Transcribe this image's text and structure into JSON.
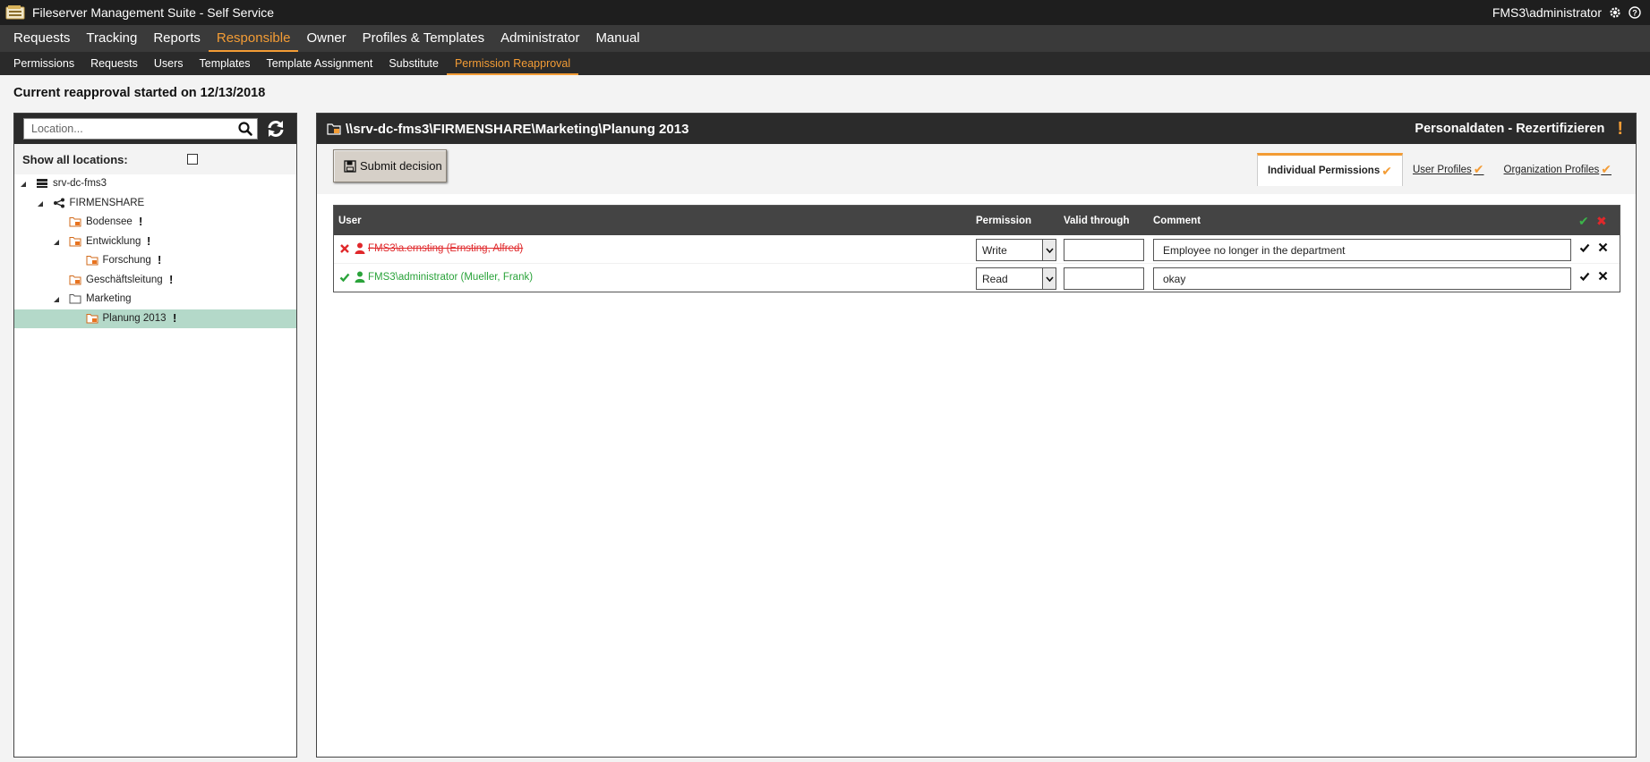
{
  "app": {
    "title": "Fileserver Management Suite - Self Service",
    "user": "FMS3\\administrator"
  },
  "main_nav": [
    {
      "label": "Requests",
      "active": false
    },
    {
      "label": "Tracking",
      "active": false
    },
    {
      "label": "Reports",
      "active": false
    },
    {
      "label": "Responsible",
      "active": true
    },
    {
      "label": "Owner",
      "active": false
    },
    {
      "label": "Profiles & Templates",
      "active": false
    },
    {
      "label": "Administrator",
      "active": false
    },
    {
      "label": "Manual",
      "active": false
    }
  ],
  "sub_nav": [
    {
      "label": "Permissions",
      "active": false
    },
    {
      "label": "Requests",
      "active": false
    },
    {
      "label": "Users",
      "active": false
    },
    {
      "label": "Templates",
      "active": false
    },
    {
      "label": "Template Assignment",
      "active": false
    },
    {
      "label": "Substitute",
      "active": false
    },
    {
      "label": "Permission Reapproval",
      "active": true
    }
  ],
  "heading": "Current reapproval started on 12/13/2018",
  "left": {
    "search_placeholder": "Location...",
    "show_all_label": "Show all locations:",
    "show_all_checked": false,
    "tree": [
      {
        "label": "srv-dc-fms3",
        "icon": "server-icon",
        "level": 0,
        "toggle": "expanded",
        "flag": false,
        "selected": false
      },
      {
        "label": "FIRMENSHARE",
        "icon": "share-icon",
        "level": 1,
        "toggle": "expanded",
        "flag": false,
        "selected": false
      },
      {
        "label": "Bodensee",
        "icon": "flagged-folder-icon",
        "level": 2,
        "toggle": "none",
        "flag": true,
        "selected": false
      },
      {
        "label": "Entwicklung",
        "icon": "flagged-folder-icon",
        "level": 2,
        "toggle": "expanded",
        "flag": true,
        "selected": false
      },
      {
        "label": "Forschung",
        "icon": "flagged-folder-icon",
        "level": 3,
        "toggle": "none",
        "flag": true,
        "selected": false
      },
      {
        "label": "Geschäftsleitung",
        "icon": "flagged-folder-icon",
        "level": 2,
        "toggle": "none",
        "flag": true,
        "selected": false
      },
      {
        "label": "Marketing",
        "icon": "folder-icon",
        "level": 2,
        "toggle": "expanded",
        "flag": false,
        "selected": false
      },
      {
        "label": "Planung 2013",
        "icon": "flagged-folder-icon",
        "level": 3,
        "toggle": "none",
        "flag": true,
        "selected": true
      }
    ]
  },
  "right": {
    "path": "\\\\srv-dc-fms3\\FIRMENSHARE\\Marketing\\Planung 2013",
    "category": "Personaldaten - Rezertifizieren",
    "submit_label": "Submit decision",
    "tabs": [
      {
        "label": "Individual Permissions",
        "active": true
      },
      {
        "label": "User Profiles",
        "active": false
      },
      {
        "label": "Organization Profiles",
        "active": false
      }
    ],
    "columns": {
      "user": "User",
      "permission": "Permission",
      "valid_through": "Valid through",
      "comment": "Comment"
    },
    "rows": [
      {
        "status": "rejected",
        "user": "FMS3\\a.ernsting (Ernsting, Alfred)",
        "permission": "Write",
        "valid_through": "",
        "comment": "Employee no longer in the department"
      },
      {
        "status": "accepted",
        "user": "FMS3\\administrator (Mueller, Frank)",
        "permission": "Read",
        "valid_through": "",
        "comment": "okay"
      }
    ]
  },
  "colors": {
    "accent": "#f39c35",
    "accept": "#2aa33a",
    "reject": "#e0282b",
    "selected_row": "#b4d9c9"
  }
}
